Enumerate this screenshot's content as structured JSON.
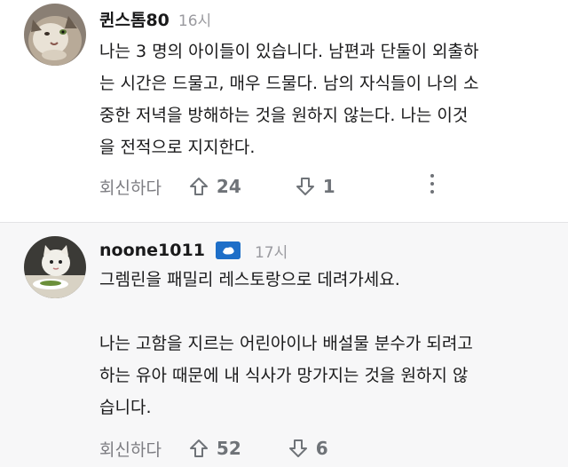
{
  "comments": [
    {
      "username": "퀸스톰80",
      "time": "16시",
      "paragraphs": [
        "나는 3 명의 아이들이 있습니다. 남편과 단둘이 외출하\n는 시간은 드물고, 매우 드물다. 남의 자식들이 나의 소\n중한 저녁을 방해하는 것을 원하지 않는다. 나는 이것\n을 전적으로 지지한다."
      ],
      "reply_label": "회신하다",
      "upvotes": "24",
      "downvotes": "1"
    },
    {
      "username": "noone1011",
      "time": "17시",
      "paragraphs": [
        "그렘린을 패밀리 레스토랑으로 데려가세요.",
        "나는 고함을 지르는 어린아이나 배설물 분수가 되려고\n하는 유아 때문에 내 식사가 망가지는 것을 원하지 않\n습니다."
      ],
      "reply_label": "회신하다",
      "upvotes": "52",
      "downvotes": "6"
    }
  ],
  "colors": {
    "text": "#1a1a1b",
    "muted": "#9a9a9f",
    "flair": "#1e6fc8"
  },
  "icons": {
    "upvote": "arrow-up-outline-icon",
    "downvote": "arrow-down-outline-icon",
    "more": "vertical-ellipsis-icon",
    "flair": "antarctica-flag-icon"
  }
}
